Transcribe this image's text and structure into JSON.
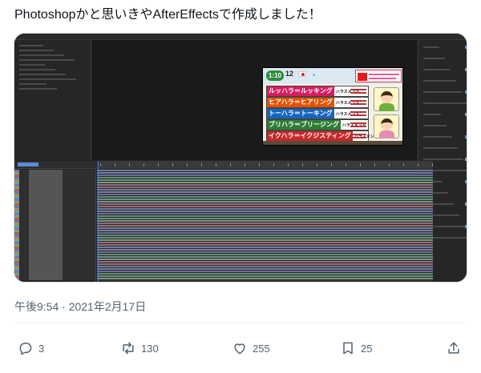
{
  "tweet": {
    "text": "Photoshopかと思いきやAfterEffectsで作成しました！",
    "timestamp": "午後9:54 · 2021年2月17日"
  },
  "media": {
    "tv": {
      "clock": "1:10",
      "header_num": "12",
      "items": [
        {
          "keyword": "ルッハラ＝ルッキング",
          "suffix": "ハラスメント",
          "color": "#d81b60"
        },
        {
          "keyword": "ヒアハラ＝ヒアリング",
          "suffix": "ハラスメント",
          "color": "#e65100"
        },
        {
          "keyword": "トーハラ＝トーキング",
          "suffix": "ハラスメント",
          "color": "#1565c0"
        },
        {
          "keyword": "ブリハラ＝ブリージング",
          "suffix": "ハラスメント",
          "color": "#2e7d32"
        },
        {
          "keyword": "イクハラ＝イクジスティング",
          "suffix": "ハラスメント",
          "color": "#c62828"
        }
      ]
    }
  },
  "actions": {
    "reply": {
      "count": "3",
      "icon": "reply-icon"
    },
    "retweet": {
      "count": "130",
      "icon": "retweet-icon"
    },
    "like": {
      "count": "255",
      "icon": "heart-icon"
    },
    "bookmark": {
      "count": "25",
      "icon": "bookmark-icon"
    },
    "share": {
      "icon": "share-icon"
    }
  }
}
